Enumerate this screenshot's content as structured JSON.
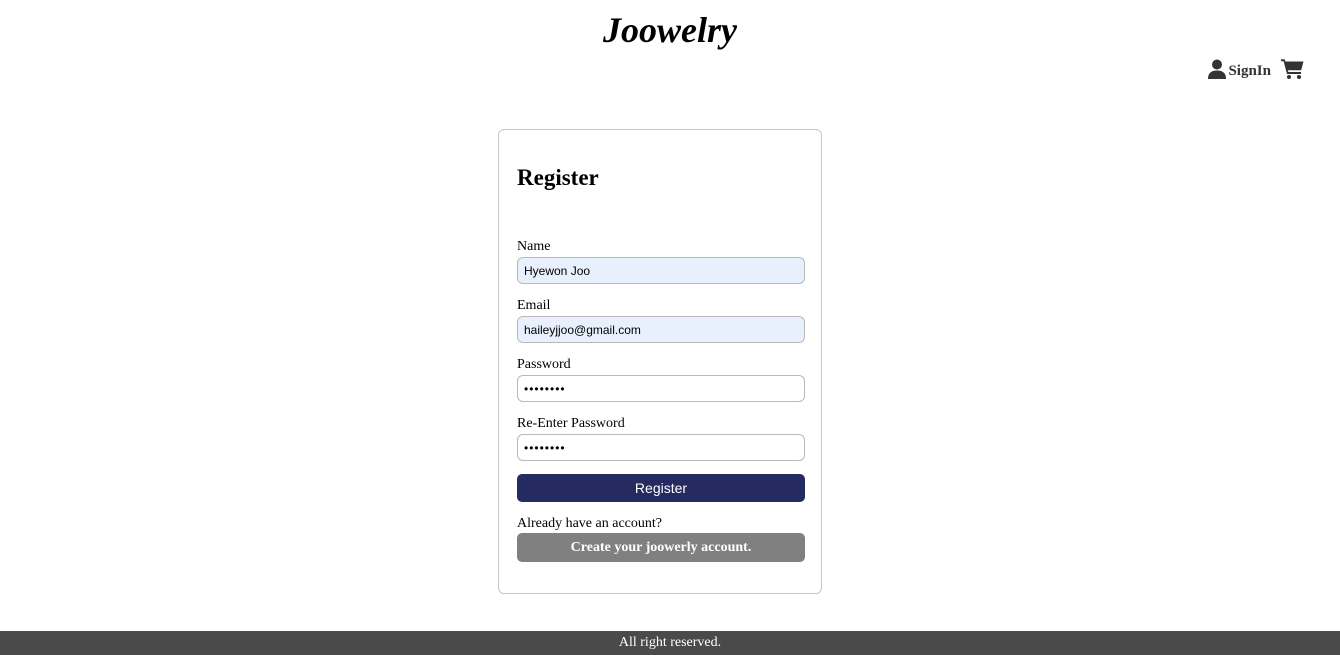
{
  "header": {
    "brand": "Joowelry",
    "signin_label": "SignIn",
    "user_icon": "user-icon",
    "cart_icon": "cart-icon",
    "icon_color": "#333333"
  },
  "form": {
    "title": "Register",
    "fields": [
      {
        "label": "Name",
        "value": "Hyewon Joo"
      },
      {
        "label": "Email",
        "value": "haileyjjoo@gmail.com"
      },
      {
        "label": "Password",
        "value": "••••••••"
      },
      {
        "label": "Re-Enter Password",
        "value": "••••••••"
      }
    ],
    "register_label": "Register",
    "register_color": "#252b61",
    "already_text": "Already have an account?",
    "create_label": "Create your joowerly account.",
    "create_color": "#808080"
  },
  "footer": {
    "text": "All right reserved."
  }
}
